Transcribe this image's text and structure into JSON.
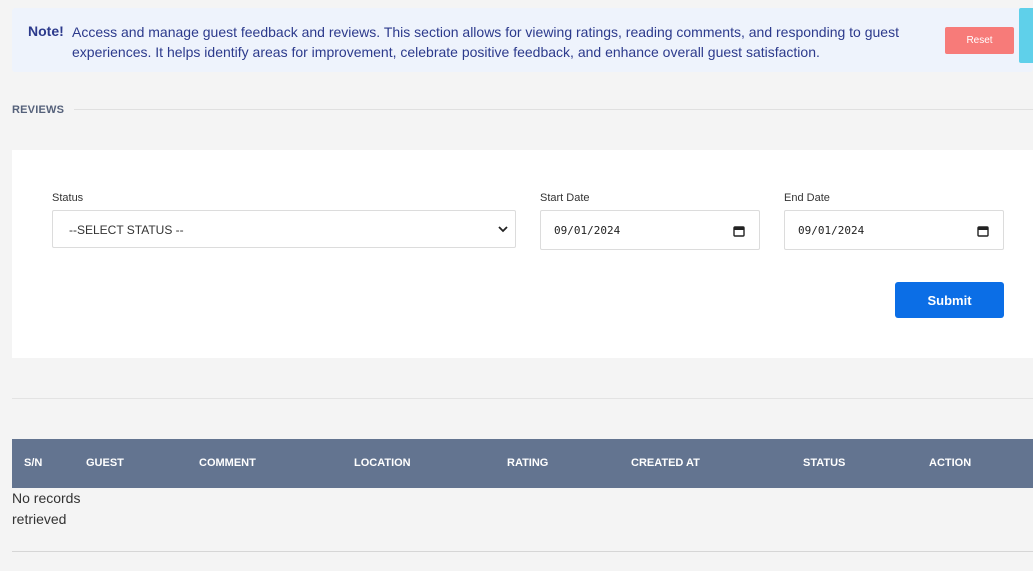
{
  "note": {
    "label": "Note!",
    "text": "Access and manage guest feedback and reviews. This section allows for viewing ratings, reading comments, and responding to guest experiences. It helps identify areas for improvement, celebrate positive feedback, and enhance overall guest satisfaction.",
    "reset_label": "Reset"
  },
  "section": {
    "title": "REVIEWS"
  },
  "filters": {
    "status_label": "Status",
    "status_value": "--SELECT STATUS --",
    "start_label": "Start Date",
    "start_value": "09/01/2024",
    "end_label": "End Date",
    "end_value": "09/01/2024",
    "submit_label": "Submit"
  },
  "table": {
    "columns": [
      "S/N",
      "GUEST",
      "COMMENT",
      "LOCATION",
      "RATING",
      "CREATED AT",
      "STATUS",
      "ACTION"
    ],
    "empty_message": "No records retrieved"
  },
  "colors": {
    "accent": "#0b6ee6",
    "reset": "#f77b79",
    "table_header": "#637490",
    "note_bg": "#eef3fc"
  }
}
